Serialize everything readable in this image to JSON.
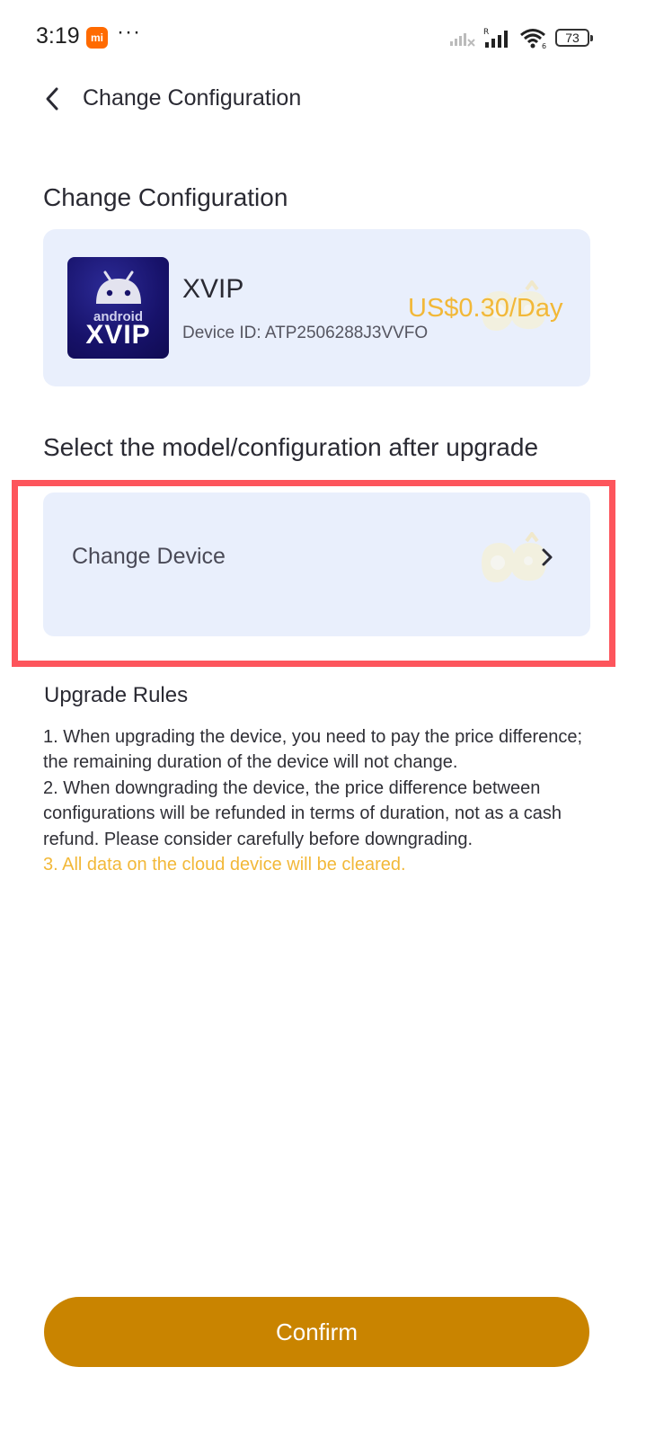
{
  "status_bar": {
    "time": "3:19",
    "badge": "mi",
    "dots": "···",
    "battery": "73"
  },
  "header": {
    "title": "Change Configuration",
    "back_icon": "chevron-left-icon"
  },
  "current": {
    "section_title": "Change Configuration",
    "logo_line1": "android",
    "logo_line2": "XVIP",
    "device_name": "XVIP",
    "device_id": "Device ID: ATP2506288J3VVFO",
    "price": "US$0.30/Day"
  },
  "upgrade": {
    "section_title": "Select the model/configuration after upgrade",
    "change_label": "Change Device",
    "chevron_icon": "chevron-right-icon"
  },
  "rules": {
    "title": "Upgrade Rules",
    "items": [
      "1. When upgrading the device, you need to pay the price difference; the remaining duration of the device will not change.",
      "2. When downgrading the device, the price difference between configurations will be refunded in terms of duration, not as a cash refund. Please consider carefully before downgrading.",
      "3. All data on the cloud device will be cleared."
    ]
  },
  "confirm_label": "Confirm",
  "colors": {
    "accent": "#c98400",
    "price": "#f2b838",
    "card_bg": "#e9effc",
    "highlight": "#fd555c"
  }
}
